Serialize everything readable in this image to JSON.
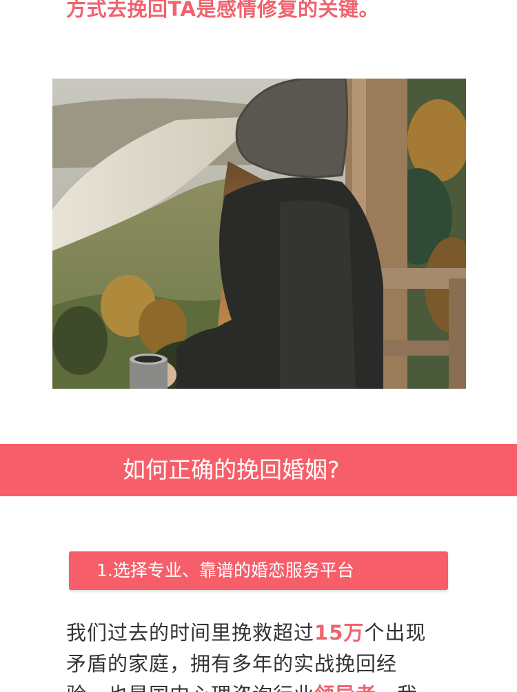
{
  "colors": {
    "accent": "#f65f6a",
    "accent_text": "#f0636e",
    "body_text": "#333333",
    "background": "#ffffff"
  },
  "intro": {
    "text": "方式去挽回TA是感情修复的关键。"
  },
  "hero_image": {
    "icon": "photo-woman-with-beanie-overlooking-river-valley"
  },
  "section": {
    "title": "如何正确的挽回婚姻?"
  },
  "point_1": {
    "label": "1.选择专业、靠谱的婚恋服务平台"
  },
  "body": {
    "line1_before": "我们过去的时间里挽救超过",
    "line1_highlight": "15万",
    "line1_after": "个出现",
    "line2": "矛盾的家庭，拥有多年的实战挽回经",
    "line3_before": "验，也是国内心理咨询行业",
    "line3_highlight": "领导者",
    "line3_after": "，我"
  }
}
